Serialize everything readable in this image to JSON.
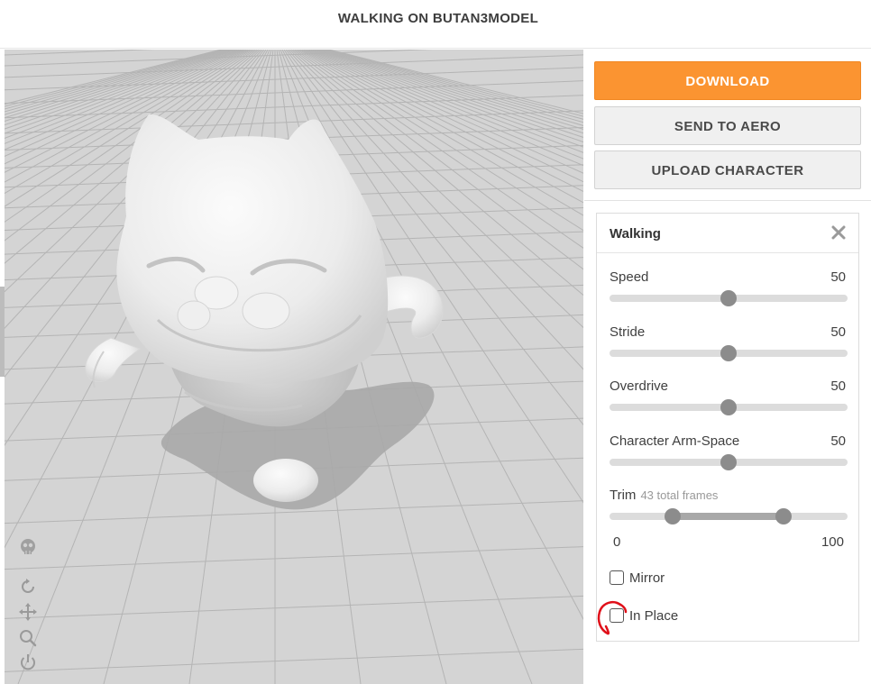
{
  "header": {
    "title": "WALKING ON BUTAN3MODEL"
  },
  "actions": {
    "download_label": "DOWNLOAD",
    "send_label": "SEND TO AERO",
    "upload_label": "UPLOAD CHARACTER"
  },
  "panel": {
    "title": "Walking",
    "params": [
      {
        "label": "Speed",
        "value": "50",
        "level": 0.5
      },
      {
        "label": "Stride",
        "value": "50",
        "level": 0.5
      },
      {
        "label": "Overdrive",
        "value": "50",
        "level": 0.5
      },
      {
        "label": "Character Arm-Space",
        "value": "50",
        "level": 0.5
      }
    ],
    "trim": {
      "label": "Trim",
      "frames_label": "43 total frames",
      "min_label": "0",
      "max_label": "100",
      "start": 0.265,
      "end": 0.73
    },
    "mirror": {
      "label": "Mirror",
      "checked": false
    },
    "in_place": {
      "label": "In Place",
      "checked": false
    }
  },
  "viewport_tools": [
    "skeleton-icon",
    "rotate-icon",
    "pan-icon",
    "zoom-icon",
    "power-icon"
  ],
  "colors": {
    "accent": "#fb9431",
    "annotation": "#e0101a",
    "floor": "#d3d3d3"
  }
}
